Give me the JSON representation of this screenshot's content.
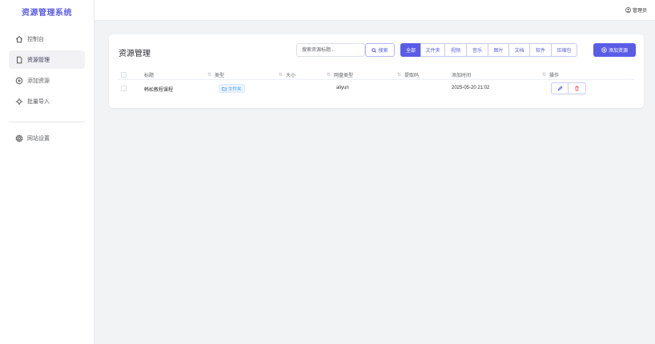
{
  "app": {
    "title": "资源管理系统"
  },
  "sidebar": {
    "items": [
      {
        "label": "控制台",
        "icon": "home-icon"
      },
      {
        "label": "资源管理",
        "icon": "file-icon",
        "active": true
      },
      {
        "label": "添加资源",
        "icon": "plus-circle-icon"
      },
      {
        "label": "批量导入",
        "icon": "import-icon"
      },
      {
        "label": "网站设置",
        "icon": "gear-icon"
      }
    ]
  },
  "header": {
    "user": "管理员",
    "user_icon": "user-icon"
  },
  "card": {
    "title": "资源管理",
    "search": {
      "placeholder": "搜索资源标题...",
      "button_label": "搜索"
    },
    "filters": [
      {
        "label": "全部",
        "active": true
      },
      {
        "label": "文件夹"
      },
      {
        "label": "视频"
      },
      {
        "label": "音乐"
      },
      {
        "label": "图片"
      },
      {
        "label": "文档"
      },
      {
        "label": "软件"
      },
      {
        "label": "压缩包"
      }
    ],
    "add_button_label": "添加资源"
  },
  "table": {
    "columns": {
      "title": "标题",
      "type": "类型",
      "size": "大小",
      "disk_type": "网盘类型",
      "extract_code": "提取码",
      "added_time": "添加时间",
      "actions": "操作"
    },
    "rows": [
      {
        "title": "韩松教程课程",
        "type": "文件夹",
        "size": "",
        "disk_type": "aliyun",
        "extract_code": "",
        "added_time": "2025-05-20 21:02"
      }
    ]
  },
  "colors": {
    "accent": "#5b5ce6",
    "tag": "#409eff",
    "danger": "#f56c6c"
  }
}
